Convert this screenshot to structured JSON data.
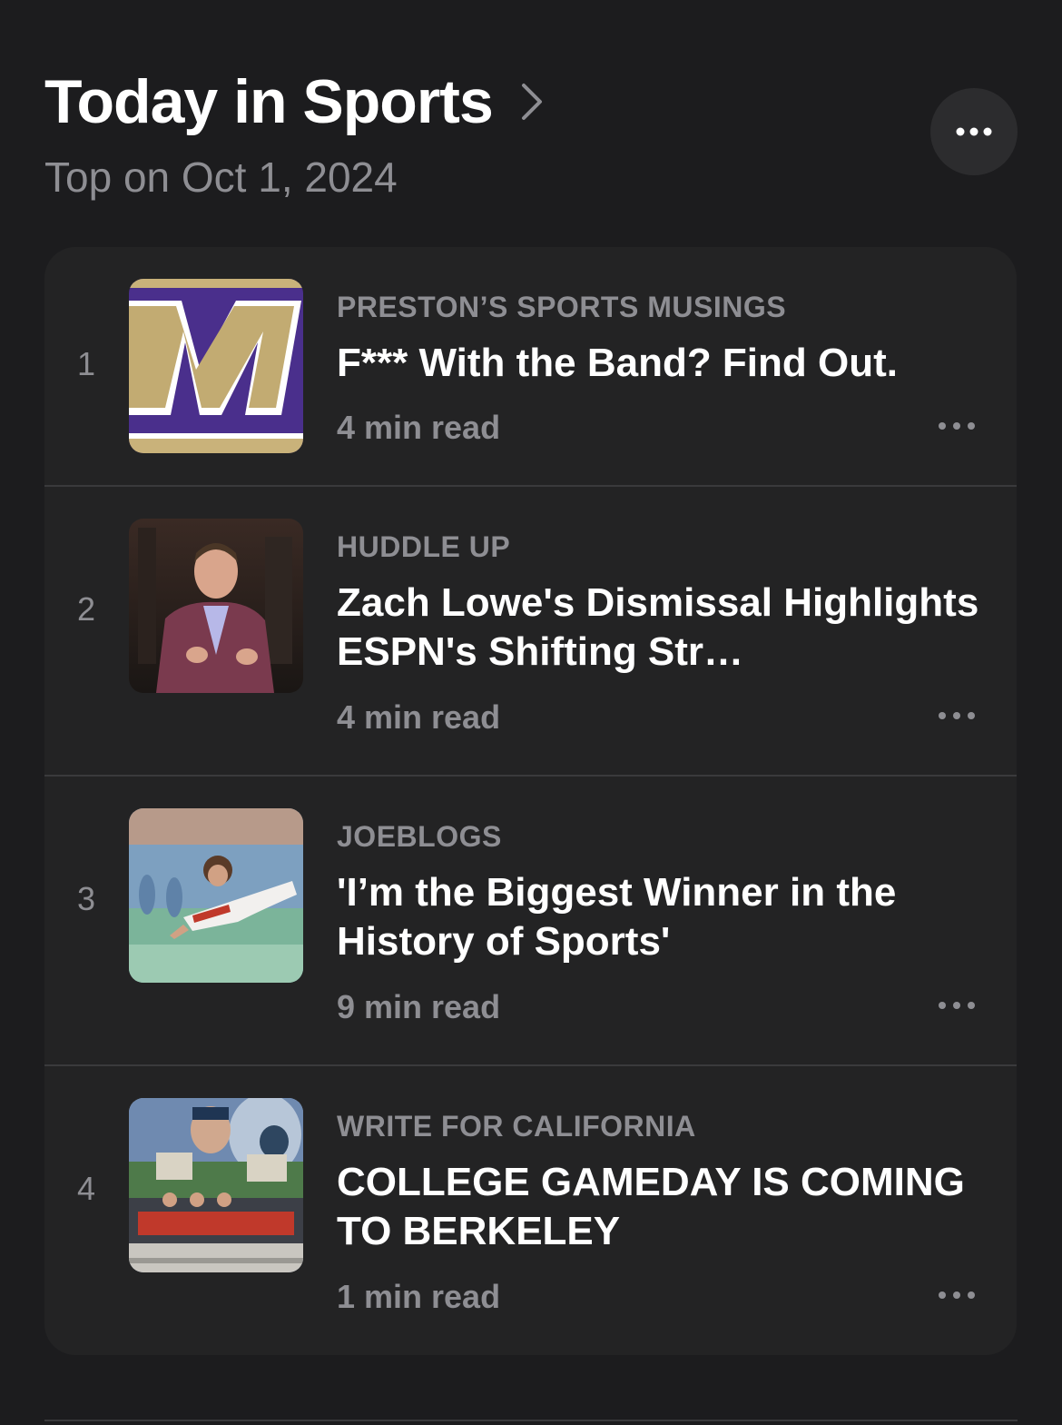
{
  "header": {
    "title": "Today in Sports",
    "subtitle": "Top on Oct 1, 2024"
  },
  "articles": [
    {
      "rank": "1",
      "source": "PRESTON’S SPORTS MUSINGS",
      "headline": "F*** With the Band? Find Out.",
      "read_time": "4 min read",
      "thumb_icon": "purple-gold-m-logo"
    },
    {
      "rank": "2",
      "source": "HUDDLE UP",
      "headline": "Zach Lowe's Dismissal Highlights ESPN's Shifting Str…",
      "read_time": "4 min read",
      "thumb_icon": "man-in-plaid-suit-photo"
    },
    {
      "rank": "3",
      "source": "JOEBLOGS",
      "headline": "'I’m the Biggest Winner in the History of Sports'",
      "read_time": "9 min read",
      "thumb_icon": "baseball-player-sliding-photo"
    },
    {
      "rank": "4",
      "source": "WRITE FOR CALIFORNIA",
      "headline": "COLLEGE GAMEDAY IS COMING TO BERKELEY",
      "read_time": "1 min read",
      "thumb_icon": "college-gameday-collage-photo"
    }
  ],
  "colors": {
    "background": "#1c1c1e",
    "card": "#232324",
    "secondary_text": "#8e8e93",
    "primary_text": "#ffffff"
  }
}
